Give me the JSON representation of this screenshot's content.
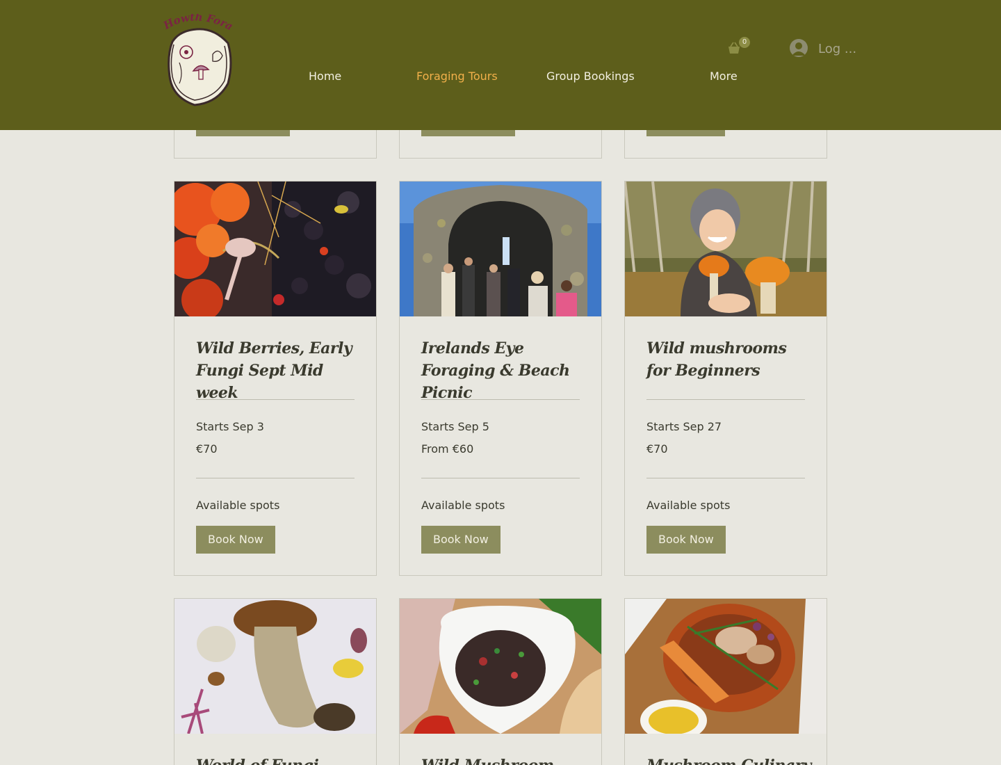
{
  "header": {
    "logo_text": "Howth Foraging",
    "nav": [
      "Home",
      "Foraging Tours",
      "Group Bookings",
      "More"
    ],
    "active_nav": "Foraging Tours",
    "cart_count": "0",
    "login_label": "Log ..."
  },
  "cards": [
    {
      "title": "Wild Berries, Early Fungi Sept Mid week",
      "date": "Starts Sep 3",
      "price": "€70",
      "spots": "Available spots",
      "button": "Book Now"
    },
    {
      "title": "Irelands Eye Foraging & Beach Picnic",
      "date": "Starts Sep 5",
      "price": "From €60",
      "spots": "Available spots",
      "button": "Book Now"
    },
    {
      "title": "Wild mushrooms for Beginners",
      "date": "Starts Sep 27",
      "price": "€70",
      "spots": "Available spots",
      "button": "Book Now"
    }
  ],
  "next_cards": [
    {
      "title": "World of Fungi, Howth"
    },
    {
      "title": "Wild Mushroom hunt &"
    },
    {
      "title": "Mushroom Culinary &"
    }
  ],
  "colors": {
    "header_bg": "#5d5e1b",
    "page_bg": "#e8e7e0",
    "active_nav": "#f2b04a",
    "button_bg": "#8c8d5e"
  }
}
